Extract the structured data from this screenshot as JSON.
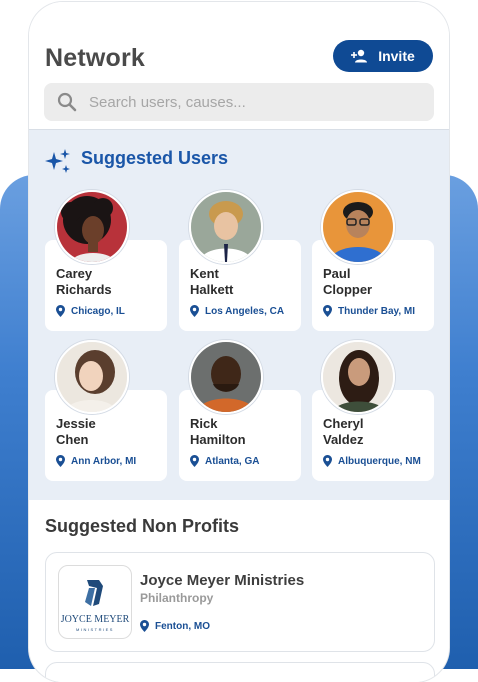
{
  "header": {
    "title": "Network",
    "invite_label": "Invite",
    "search_placeholder": "Search users, causes..."
  },
  "suggested_users": {
    "title": "Suggested Users",
    "users": [
      {
        "first": "Carey",
        "last": "Richards",
        "location": "Chicago, IL"
      },
      {
        "first": "Kent",
        "last": "Halkett",
        "location": "Los Angeles, CA"
      },
      {
        "first": "Paul",
        "last": "Clopper",
        "location": "Thunder Bay, MI"
      },
      {
        "first": "Jessie",
        "last": "Chen",
        "location": "Ann Arbor, MI"
      },
      {
        "first": "Rick",
        "last": "Hamilton",
        "location": "Atlanta, GA"
      },
      {
        "first": "Cheryl",
        "last": "Valdez",
        "location": "Albuquerque, NM"
      }
    ]
  },
  "suggested_nonprofits": {
    "title": "Suggested Non Profits",
    "items": [
      {
        "name": "Joyce Meyer Ministries",
        "category": "Philanthropy",
        "location": "Fenton, MO",
        "logo_text": "JOYCE MEYER",
        "logo_subtext": "MINISTRIES"
      }
    ]
  },
  "colors": {
    "brand": "#0f4a94",
    "accent_text": "#1a56a8",
    "section_bg": "#e8eef6",
    "backdrop": "#3f7fcf"
  }
}
